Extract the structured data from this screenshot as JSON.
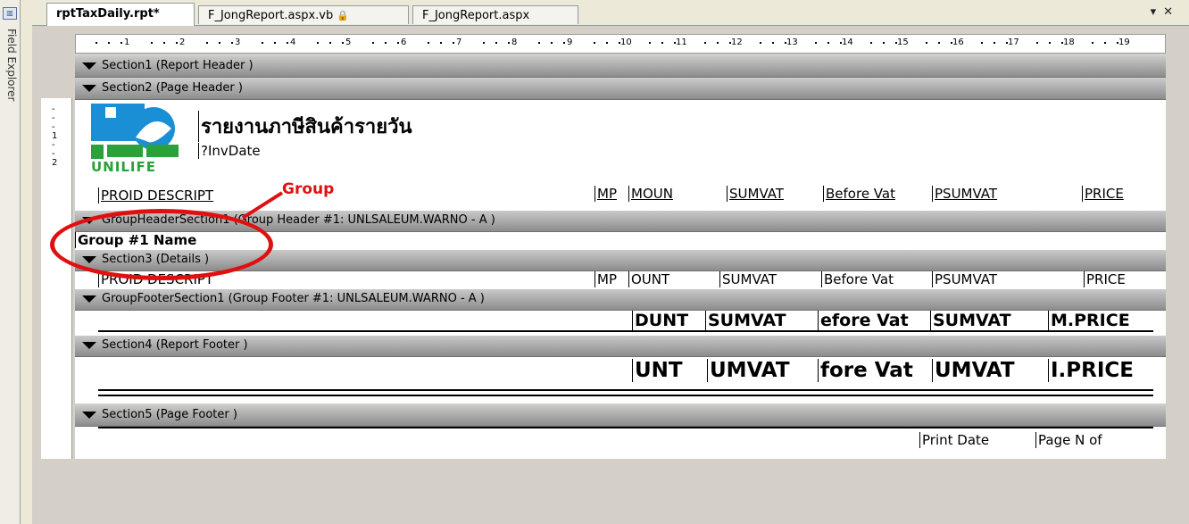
{
  "field_explorer": {
    "label": "Field Explorer",
    "icon": "field-explorer-icon"
  },
  "tabs": [
    {
      "label": "rptTaxDaily.rpt*",
      "active": true
    },
    {
      "label": "F_JongReport.aspx.vb",
      "locked": true
    },
    {
      "label": "F_JongReport.aspx"
    }
  ],
  "tab_controls": {
    "dropdown": "▾",
    "close": "✕"
  },
  "ruler": {
    "numbers": [
      "1",
      "2",
      "3",
      "4",
      "5",
      "6",
      "7",
      "8",
      "9",
      "10",
      "11",
      "12",
      "13",
      "14",
      "15",
      "16",
      "17",
      "18",
      "19"
    ]
  },
  "sections": {
    "s1": "Section1 (Report Header )",
    "s2": "Section2 (Page Header )",
    "gh": "GroupHeaderSection1 (Group Header #1: UNLSALEUM.WARNO - A )",
    "s3": "Section3 (Details )",
    "gf": "GroupFooterSection1 (Group Footer #1: UNLSALEUM.WARNO - A )",
    "s4": "Section4 (Report Footer )",
    "s5": "Section5 (Page Footer )"
  },
  "page_header": {
    "logo_text": "UNILIFE",
    "title": "รายงานภาษีสินค้ารายวัน",
    "inv_date": "?InvDate",
    "columns": [
      "PROID DESCRIPT",
      "MP",
      "MOUN",
      "SUMVAT",
      "Before Vat",
      "PSUMVAT",
      "PRICE"
    ]
  },
  "group_header": {
    "name": "Group #1 Name"
  },
  "details": {
    "columns": [
      "PROID DESCRIPT",
      "MP",
      "OUNT",
      "SUMVAT",
      "Before Vat",
      "PSUMVAT",
      "PRICE"
    ]
  },
  "group_footer": {
    "columns": [
      "DUNT",
      "SUMVAT",
      "efore Vat",
      "SUMVAT",
      "M.PRICE"
    ]
  },
  "report_footer": {
    "columns": [
      "UNT",
      "UMVAT",
      "fore Vat",
      "UMVAT",
      "I.PRICE"
    ]
  },
  "page_footer": {
    "print_date": "Print Date",
    "page_n": "Page N of"
  },
  "annotation": {
    "text": "Group",
    "color": "#e01010"
  }
}
